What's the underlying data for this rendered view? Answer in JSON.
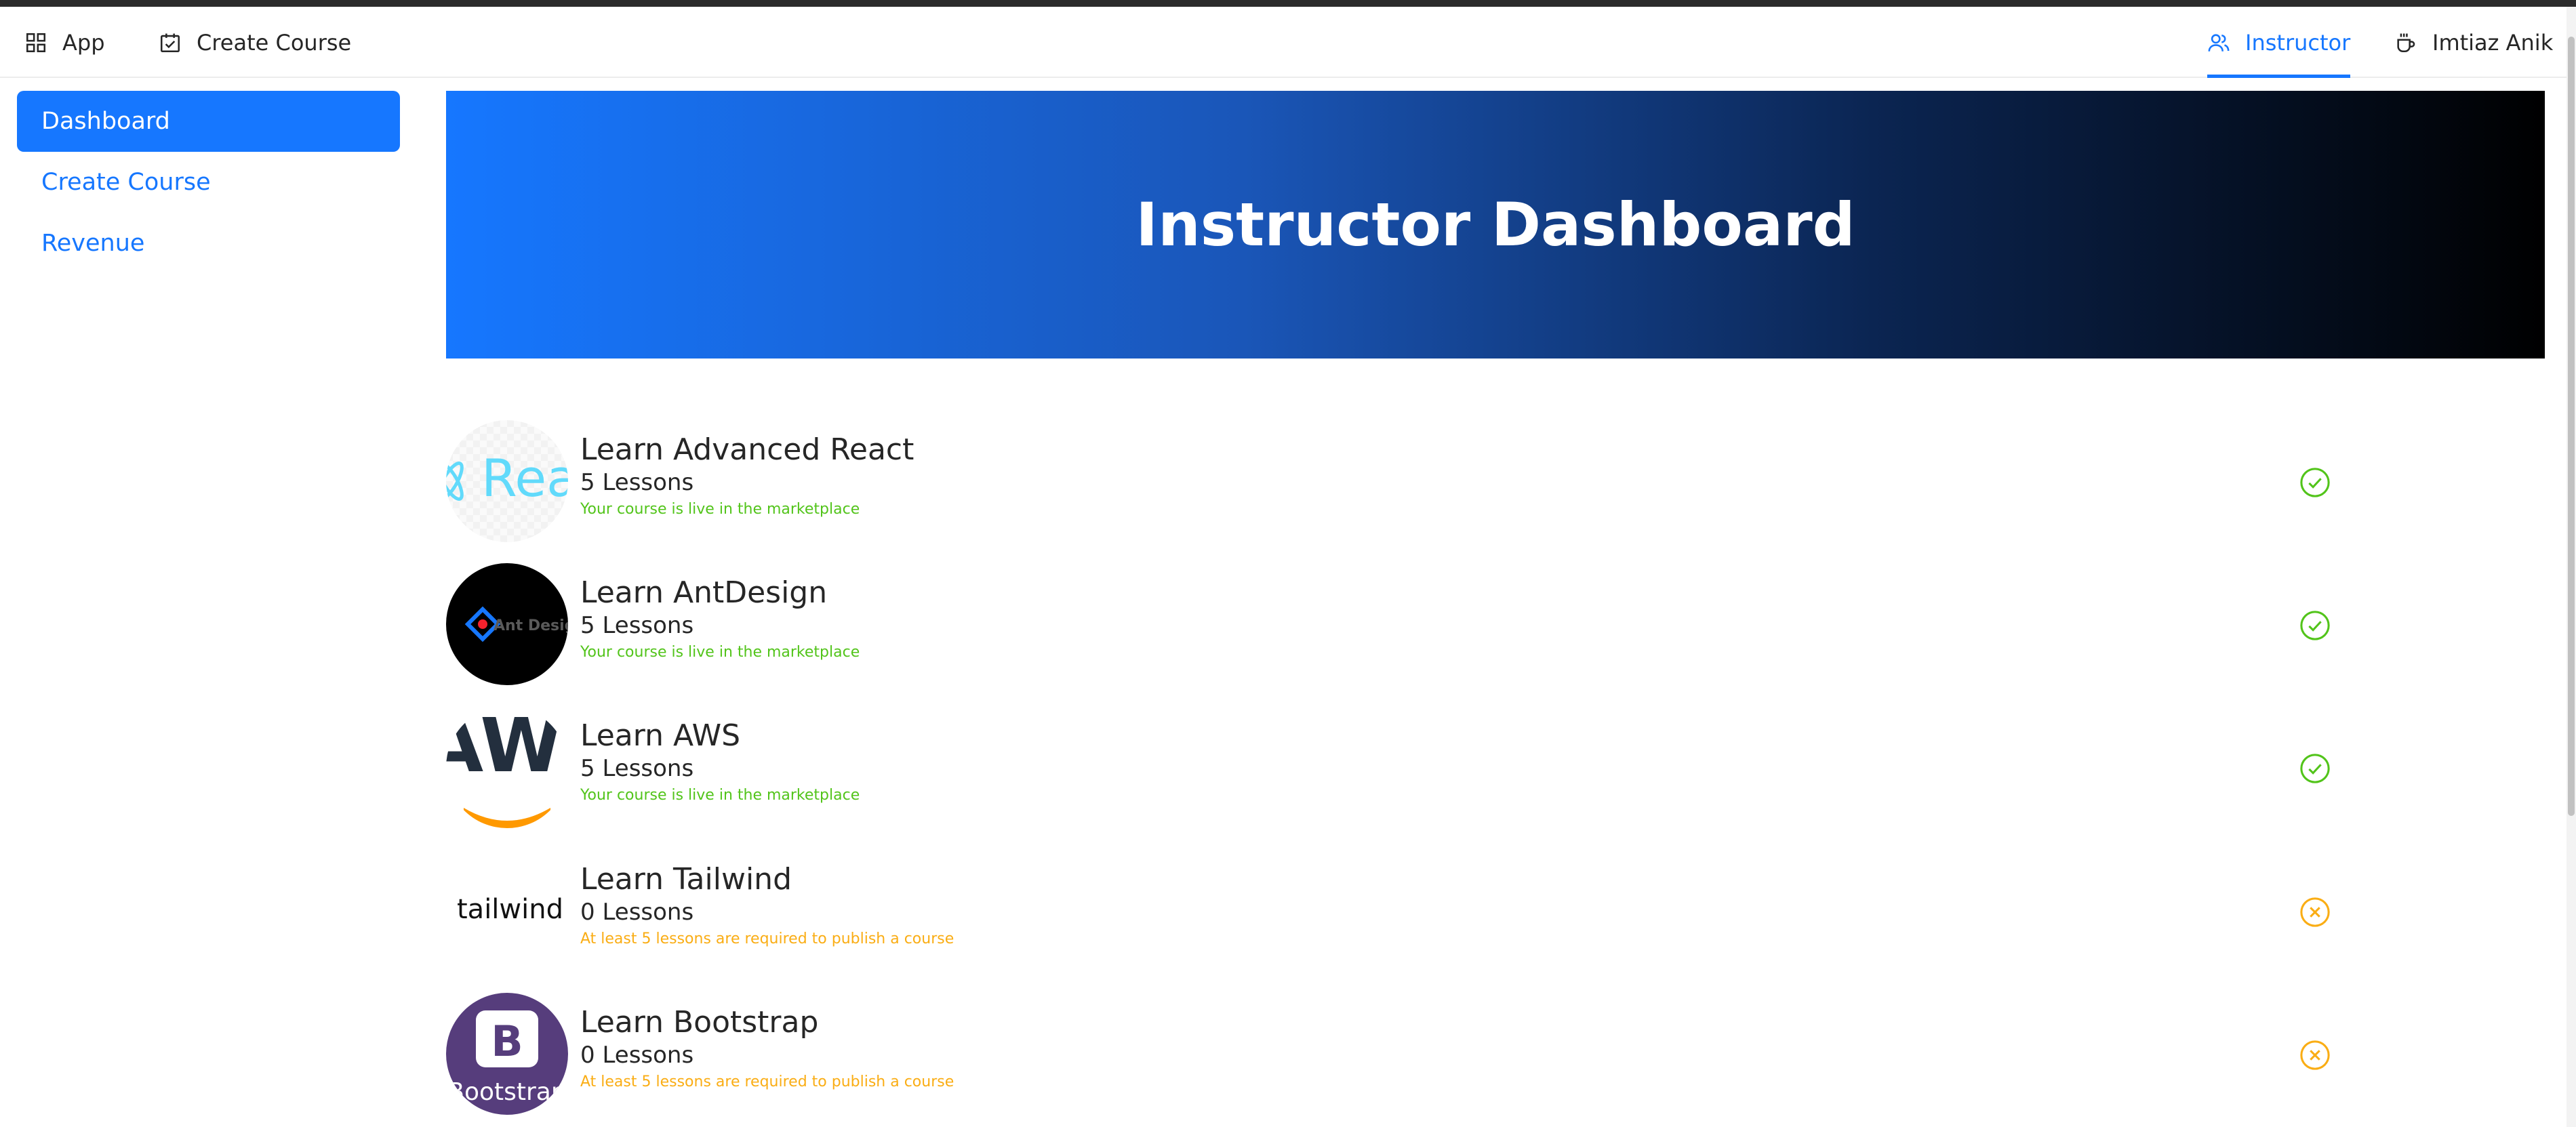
{
  "topnav": {
    "app_label": "App",
    "create_course_label": "Create Course",
    "instructor_label": "Instructor",
    "user_name": "Imtiaz Anik"
  },
  "sidebar": {
    "items": [
      {
        "label": "Dashboard",
        "active": true
      },
      {
        "label": "Create Course",
        "active": false
      },
      {
        "label": "Revenue",
        "active": false
      }
    ]
  },
  "hero": {
    "title": "Instructor Dashboard"
  },
  "courses": [
    {
      "title": "Learn Advanced React",
      "lessons": "5 Lessons",
      "status": "Your course is live in the marketplace",
      "state": "published",
      "thumb_text": "Rea"
    },
    {
      "title": "Learn AntDesign",
      "lessons": "5 Lessons",
      "status": "Your course is live in the marketplace",
      "state": "published",
      "thumb_text": "Ant Design"
    },
    {
      "title": "Learn AWS",
      "lessons": "5 Lessons",
      "status": "Your course is live in the marketplace",
      "state": "published",
      "thumb_text": "AWS"
    },
    {
      "title": "Learn Tailwind",
      "lessons": "0 Lessons",
      "status": "At least 5 lessons are required to publish a course",
      "state": "unpublished",
      "thumb_text": "tailwind"
    },
    {
      "title": "Learn Bootstrap",
      "lessons": "0 Lessons",
      "status": "At least 5 lessons are required to publish a course",
      "state": "unpublished",
      "thumb_text": "Bootstrap"
    }
  ],
  "colors": {
    "primary": "#1677ff",
    "success": "#52c41a",
    "warning": "#faad14",
    "hero_gradient_end": "#000000"
  },
  "icons": {
    "app": "appstore-icon",
    "create_course": "carry-out-icon",
    "instructor": "team-icon",
    "user": "coffee-icon",
    "published": "check-circle-icon",
    "unpublished": "close-circle-icon"
  }
}
